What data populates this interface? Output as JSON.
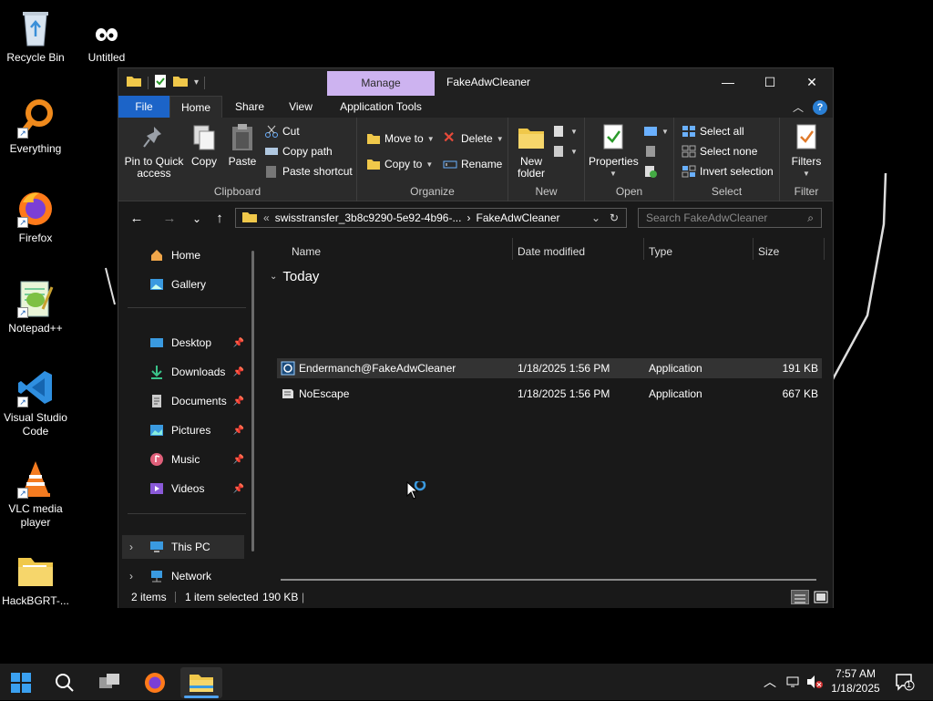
{
  "desktop": {
    "icons": [
      {
        "label": "Recycle Bin",
        "icon": "recycle-bin-icon"
      },
      {
        "label": "Untitled",
        "icon": "untitled-icon"
      },
      {
        "label": "Everything",
        "icon": "everything-icon"
      },
      {
        "label": "Firefox",
        "icon": "firefox-icon"
      },
      {
        "label": "Notepad++",
        "icon": "notepad-plus-plus-icon"
      },
      {
        "label": "Visual Studio Code",
        "icon": "vscode-icon"
      },
      {
        "label": "VLC media player",
        "icon": "vlc-icon"
      },
      {
        "label": "HackBGRT-...",
        "icon": "folder-icon"
      }
    ]
  },
  "window": {
    "title": "FakeAdwCleaner",
    "contextual_tab": "Manage",
    "controls": {
      "minimize": "—",
      "maximize": "☐",
      "close": "✕"
    }
  },
  "ribbon_tabs": [
    "File",
    "Home",
    "Share",
    "View",
    "Application Tools"
  ],
  "ribbon": {
    "clipboard": {
      "label": "Clipboard",
      "pin": "Pin to Quick access",
      "copy": "Copy",
      "paste": "Paste",
      "cut": "Cut",
      "copy_path": "Copy path",
      "paste_shortcut": "Paste shortcut"
    },
    "organize": {
      "label": "Organize",
      "move_to": "Move to",
      "copy_to": "Copy to",
      "delete": "Delete",
      "rename": "Rename"
    },
    "new": {
      "label": "New",
      "new_folder": "New folder"
    },
    "open": {
      "label": "Open",
      "properties": "Properties"
    },
    "select": {
      "label": "Select",
      "select_all": "Select all",
      "select_none": "Select none",
      "invert_selection": "Invert selection"
    },
    "filter": {
      "label": "Filter",
      "filters": "Filters"
    }
  },
  "nav": {
    "address_prefix": "«",
    "address_parent": "swisstransfer_3b8c9290-5e92-4b96-...",
    "address_sep": "›",
    "address_current": "FakeAdwCleaner",
    "search_placeholder": "Search FakeAdwCleaner"
  },
  "sidebar": {
    "items": [
      {
        "label": "Home",
        "pinned": false
      },
      {
        "label": "Gallery",
        "pinned": false
      },
      {
        "label": "Desktop",
        "pinned": true
      },
      {
        "label": "Downloads",
        "pinned": true
      },
      {
        "label": "Documents",
        "pinned": true
      },
      {
        "label": "Pictures",
        "pinned": true
      },
      {
        "label": "Music",
        "pinned": true
      },
      {
        "label": "Videos",
        "pinned": true
      },
      {
        "label": "This PC",
        "pinned": false
      },
      {
        "label": "Network",
        "pinned": false
      }
    ]
  },
  "filelist": {
    "columns": [
      "Name",
      "Date modified",
      "Type",
      "Size"
    ],
    "group": "Today",
    "rows": [
      {
        "name": "Endermanch@FakeAdwCleaner",
        "date": "1/18/2025 1:56 PM",
        "type": "Application",
        "size": "191 KB",
        "selected": true
      },
      {
        "name": "NoEscape",
        "date": "1/18/2025 1:56 PM",
        "type": "Application",
        "size": "667 KB",
        "selected": false
      }
    ]
  },
  "status": {
    "items": "2 items",
    "selected": "1 item selected",
    "size": "190 KB",
    "sep": "|"
  },
  "taskbar": {
    "time": "7:57 AM",
    "date": "1/18/2025",
    "notifications": "1"
  },
  "colors": {
    "accent": "#1c64c8",
    "manage_tab": "#cdb3f0",
    "window_bg": "#191919",
    "ribbon_bg": "#2b2b2b"
  }
}
